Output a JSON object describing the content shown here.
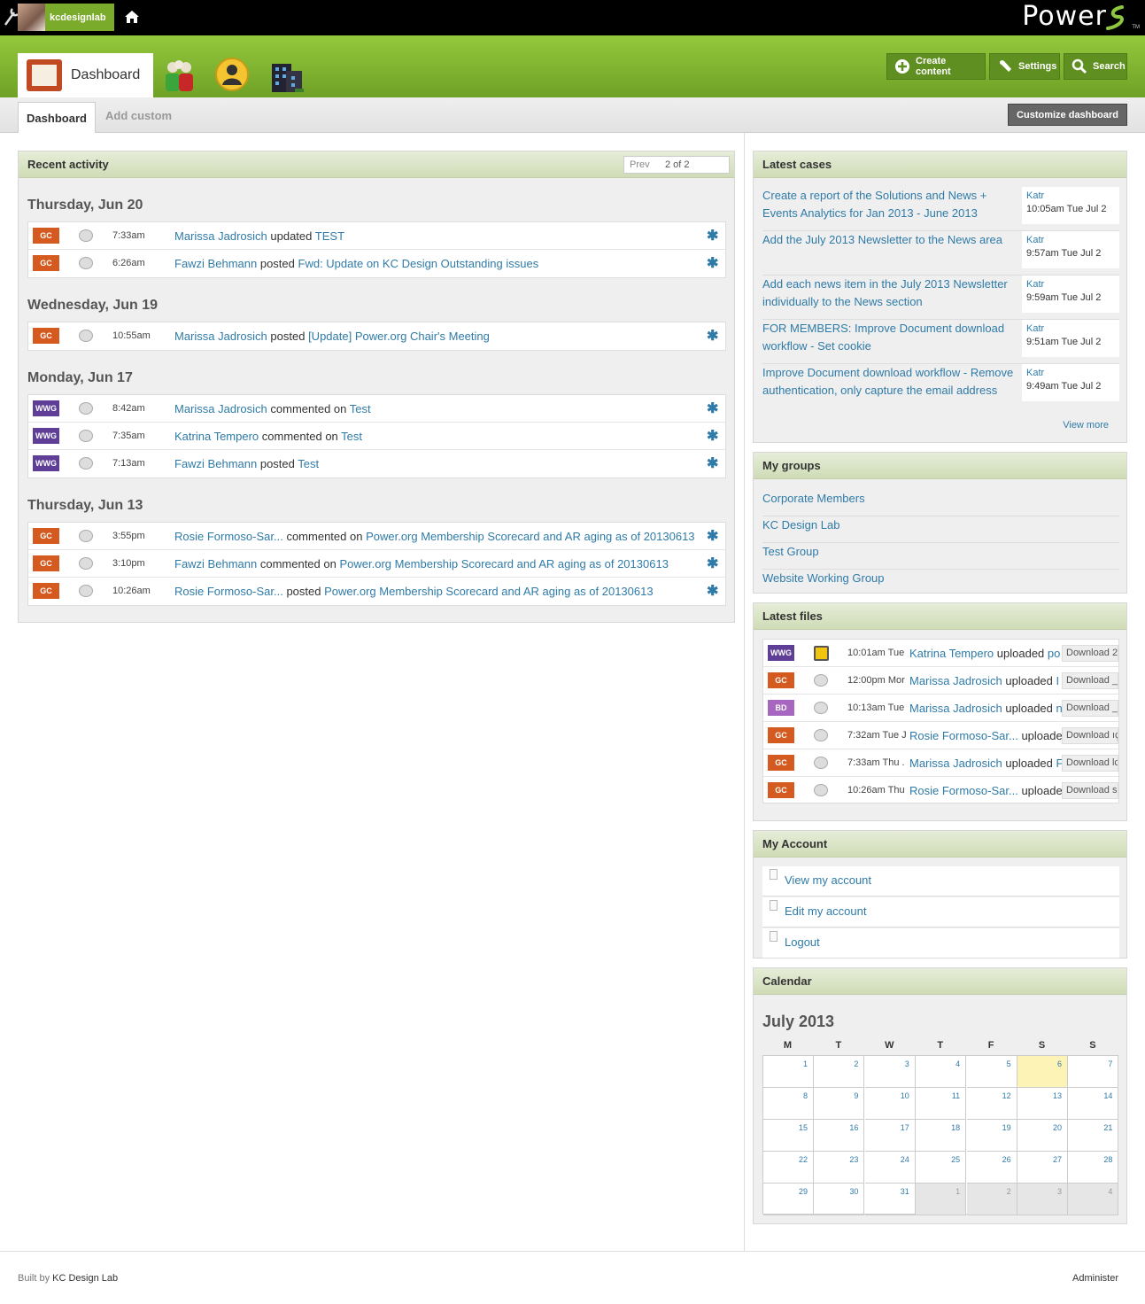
{
  "topbar": {
    "username": "kcdesignlab",
    "logo_text": "Power",
    "logo_tm": "TM",
    "tools_icon": "wrench-icon",
    "home_icon": "home-icon"
  },
  "header": {
    "tabs": [
      {
        "label": "Dashboard",
        "icon": "dashboard-icon",
        "active": true
      },
      {
        "label": "",
        "icon": "people-icon"
      },
      {
        "label": "",
        "icon": "profile-icon"
      },
      {
        "label": "",
        "icon": "organization-icon"
      }
    ],
    "buttons": {
      "create": "Create content",
      "settings": "Settings",
      "search": "Search"
    }
  },
  "subtabs": {
    "dashboard": "Dashboard",
    "add_custom": "Add custom",
    "customize": "Customize dashboard"
  },
  "colors": {
    "brand_green": "#7aab2a",
    "link_blue": "#2f7ba8",
    "badge_gc": "#d45a1f",
    "badge_wwg": "#5e3e96",
    "badge_bd": "#a766bf",
    "today": "#fdf3b6"
  },
  "recent": {
    "title": "Recent activity",
    "pager_prev": "Prev",
    "pager_count": "2 of 2",
    "days": [
      {
        "date": "Thursday, Jun 20",
        "items": [
          {
            "badge": "GC",
            "time": "7:33am",
            "user": "Marissa Jadrosich",
            "verb": "updated",
            "target": "TEST"
          },
          {
            "badge": "GC",
            "time": "6:26am",
            "user": "Fawzi Behmann",
            "verb": "posted",
            "target": "Fwd: Update on KC Design Outstanding issues"
          }
        ]
      },
      {
        "date": "Wednesday, Jun 19",
        "items": [
          {
            "badge": "GC",
            "time": "10:55am",
            "user": "Marissa Jadrosich",
            "verb": "posted",
            "target": "[Update] Power.org Chair's Meeting"
          }
        ]
      },
      {
        "date": "Monday, Jun 17",
        "items": [
          {
            "badge": "WWG",
            "time": "8:42am",
            "user": "Marissa Jadrosich",
            "verb": "commented on",
            "target": "Test"
          },
          {
            "badge": "WWG",
            "time": "7:35am",
            "user": "Katrina Tempero",
            "verb": "commented on",
            "target": "Test"
          },
          {
            "badge": "WWG",
            "time": "7:13am",
            "user": "Fawzi Behmann",
            "verb": "posted",
            "target": "Test"
          }
        ]
      },
      {
        "date": "Thursday, Jun 13",
        "items": [
          {
            "badge": "GC",
            "time": "3:55pm",
            "user": "Rosie Formoso-Sar...",
            "verb": "commented on",
            "target": "Power.org Membership Scorecard and AR aging as of 20130613"
          },
          {
            "badge": "GC",
            "time": "3:10pm",
            "user": "Fawzi Behmann",
            "verb": "commented on",
            "target": "Power.org Membership Scorecard and AR aging as of 20130613"
          },
          {
            "badge": "GC",
            "time": "10:26am",
            "user": "Rosie Formoso-Sar...",
            "verb": "posted",
            "target": "Power.org Membership Scorecard and AR aging as of 20130613"
          }
        ]
      }
    ]
  },
  "cases": {
    "title": "Latest cases",
    "view_more": "View more",
    "items": [
      {
        "title": "Create a report of the Solutions and News + Events Analytics for Jan 2013 - June 2013",
        "author": "Katr",
        "time": "10:05am Tue Jul 2"
      },
      {
        "title": "Add the July 2013 Newsletter to the News area",
        "author": "Katr",
        "time": "9:57am Tue Jul 2"
      },
      {
        "title": "Add each news item in the July 2013 Newsletter individually to the News section",
        "author": "Katr",
        "time": "9:59am Tue Jul 2"
      },
      {
        "title": "FOR MEMBERS: Improve Document download workflow - Set cookie",
        "author": "Katr",
        "time": "9:51am Tue Jul 2"
      },
      {
        "title": "Improve Document download workflow - Remove authentication, only capture the email address",
        "author": "Katr",
        "time": "9:49am Tue Jul 2"
      }
    ]
  },
  "groups": {
    "title": "My groups",
    "items": [
      "Corporate Members",
      "KC Design Lab",
      "Test Group",
      "Website Working Group"
    ]
  },
  "files": {
    "title": "Latest files",
    "download_label": "Download",
    "items": [
      {
        "badge": "WWG",
        "icon": "folder-icon",
        "time": "10:01am Tue",
        "user": "Katrina Tempero",
        "verb": "uploaded",
        "target": "po",
        "dl_suffix": "2"
      },
      {
        "badge": "GC",
        "icon": "comment-icon",
        "time": "12:00pm Mor",
        "user": "Marissa Jadrosich",
        "verb": "uploaded",
        "target": "I",
        "dl_suffix": "_"
      },
      {
        "badge": "BD",
        "icon": "comment-icon",
        "time": "10:13am Tue",
        "user": "Marissa Jadrosich",
        "verb": "uploaded",
        "target": "n",
        "dl_suffix": "_f"
      },
      {
        "badge": "GC",
        "icon": "comment-icon",
        "time": "7:32am Tue J",
        "user": "Rosie Formoso-Sar...",
        "verb": "uploade",
        "target": "",
        "dl_suffix": "ıç"
      },
      {
        "badge": "GC",
        "icon": "comment-icon",
        "time": "7:33am Thu .",
        "user": "Marissa Jadrosich",
        "verb": "uploaded",
        "target": "F",
        "dl_suffix": "lc"
      },
      {
        "badge": "GC",
        "icon": "comment-icon",
        "time": "10:26am Thu",
        "user": "Rosie Formoso-Sar...",
        "verb": "uploade",
        "target": "",
        "dl_suffix": "s"
      }
    ]
  },
  "account": {
    "title": "My Account",
    "items": [
      "View my account",
      "Edit my account",
      "Logout"
    ]
  },
  "calendar": {
    "title": "Calendar",
    "month": "July 2013",
    "dow": [
      "M",
      "T",
      "W",
      "T",
      "F",
      "S",
      "S"
    ],
    "today": 6,
    "weeks": [
      [
        1,
        2,
        3,
        4,
        5,
        6,
        7
      ],
      [
        8,
        9,
        10,
        11,
        12,
        13,
        14
      ],
      [
        15,
        16,
        17,
        18,
        19,
        20,
        21
      ],
      [
        22,
        23,
        24,
        25,
        26,
        27,
        28
      ],
      [
        29,
        30,
        31,
        1,
        2,
        3,
        4
      ]
    ],
    "other_month_from": 3
  },
  "footer": {
    "built_prefix": "Built by",
    "built_name": "KC Design Lab",
    "administer": "Administer"
  }
}
